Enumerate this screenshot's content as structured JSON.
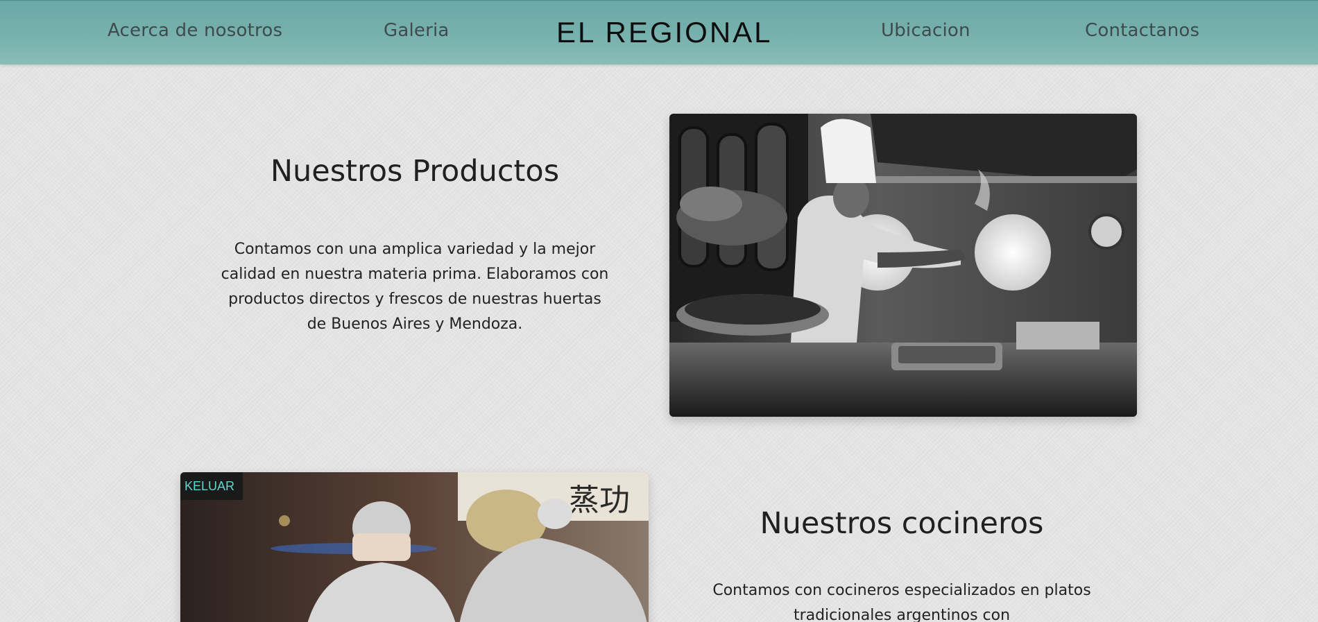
{
  "nav": {
    "about": "Acerca de nosotros",
    "gallery": "Galeria",
    "brand": "EL REGIONAL",
    "location": "Ubicacion",
    "contact": "Contactanos"
  },
  "products": {
    "title": "Nuestros Productos",
    "text": "Contamos con una amplica variedad y la mejor calidad en nuestra materia prima. Elaboramos con productos directos y frescos de nuestras huertas de Buenos Aires y Mendoza."
  },
  "cooks": {
    "title": "Nuestros cocineros",
    "text": "Contamos con cocineros especializados en platos tradicionales argentinos con"
  },
  "photos": {
    "cooks_sign_text": "KELUAR",
    "cooks_hanzi": "蒸功"
  },
  "colors": {
    "header": "#79b2ae",
    "background": "#e4e4e4"
  }
}
